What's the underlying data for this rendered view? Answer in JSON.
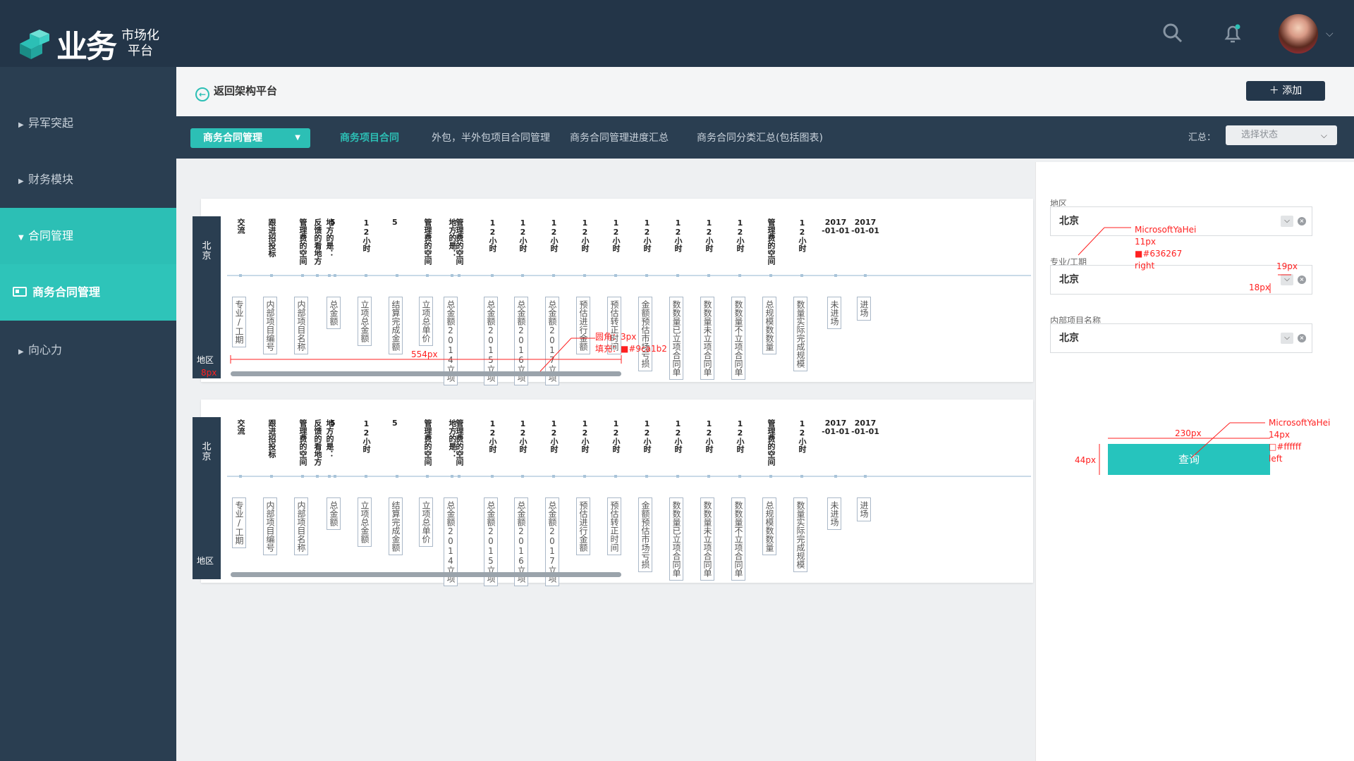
{
  "brand": {
    "main": "业务",
    "sub1": "市场化",
    "sub2": "平台"
  },
  "topbar": {
    "icons": [
      "search-icon",
      "bell-icon"
    ]
  },
  "sidebar": {
    "items": [
      {
        "label": "异军突起"
      },
      {
        "label": "财务模块"
      },
      {
        "label": "合同管理"
      },
      {
        "label": "商务合同管理"
      },
      {
        "label": "向心力"
      }
    ]
  },
  "header": {
    "back_label": "返回架构平台",
    "add_label": "添加"
  },
  "tabs": {
    "select_label": "商务合同管理",
    "items": [
      "商务项目合同",
      "外包，半外包项目合同管理",
      "商务合同管理进度汇总",
      "商务合同分类汇总(包括图表)"
    ],
    "summary_label": "汇总：",
    "summary_placeholder": "选择状态"
  },
  "table": {
    "region_vertical": "北京",
    "region_label": "地区",
    "columns": [
      {
        "header": "交流",
        "box": "专业/工期"
      },
      {
        "header": "跟进招投标",
        "box": "内部项目编号"
      },
      {
        "header": "管理费的空间",
        "box": "内部项目名称"
      },
      {
        "header": "反馈的看地方",
        "box": ""
      },
      {
        "header": "地方的是：",
        "box": ""
      },
      {
        "header": "5",
        "box": "总金额"
      },
      {
        "header": "12小时",
        "box": "立项总金额"
      },
      {
        "header": "5",
        "box": "结算完成金额"
      },
      {
        "header": "管理费的空间",
        "box": "立项总单价"
      },
      {
        "header": "地方的是：",
        "box": "总金额2014立项"
      },
      {
        "header": "管理费的空间",
        "box": ""
      },
      {
        "header": "12小时",
        "box": "总金额2015立项"
      },
      {
        "header": "12小时",
        "box": "总金额2016立项"
      },
      {
        "header": "12小时",
        "box": "总金额2017立项"
      },
      {
        "header": "12小时",
        "box": "预估进行金额"
      },
      {
        "header": "12小时",
        "box": "预估转正时间"
      },
      {
        "header": "12小时",
        "box": "金额预估市场亏损"
      },
      {
        "header": "12小时",
        "box": "数数量已立项合同单"
      },
      {
        "header": "12小时",
        "box": "数数量未立项合同单"
      },
      {
        "header": "12小时",
        "box": "数数量不立项合同单"
      },
      {
        "header": "管理费的空间",
        "box": "总规模数数量"
      },
      {
        "header": "12小时",
        "box": "数量实际完成规模"
      },
      {
        "header": "2017-01-01",
        "box": "未进场"
      },
      {
        "header": "2017-01-01",
        "box": "进场"
      }
    ]
  },
  "filters": {
    "fields": [
      {
        "label": "地区",
        "value": "北京"
      },
      {
        "label": "专业/工期",
        "value": "北京"
      },
      {
        "label": "内部项目名称",
        "value": "北京"
      }
    ],
    "query_label": "查询"
  },
  "annotations": {
    "a1": "MicrosoftYaHei\n11px\n■#636267\nright",
    "a2": "19px",
    "a3": "18px",
    "a4": "MicrosoftYaHei\n14px\n□#ffffff\nleft",
    "a5": "230px",
    "a6": "44px",
    "a7": "圆角：3px\n填充：■#9ca1b2",
    "a8": "554px",
    "a9": "8px"
  }
}
